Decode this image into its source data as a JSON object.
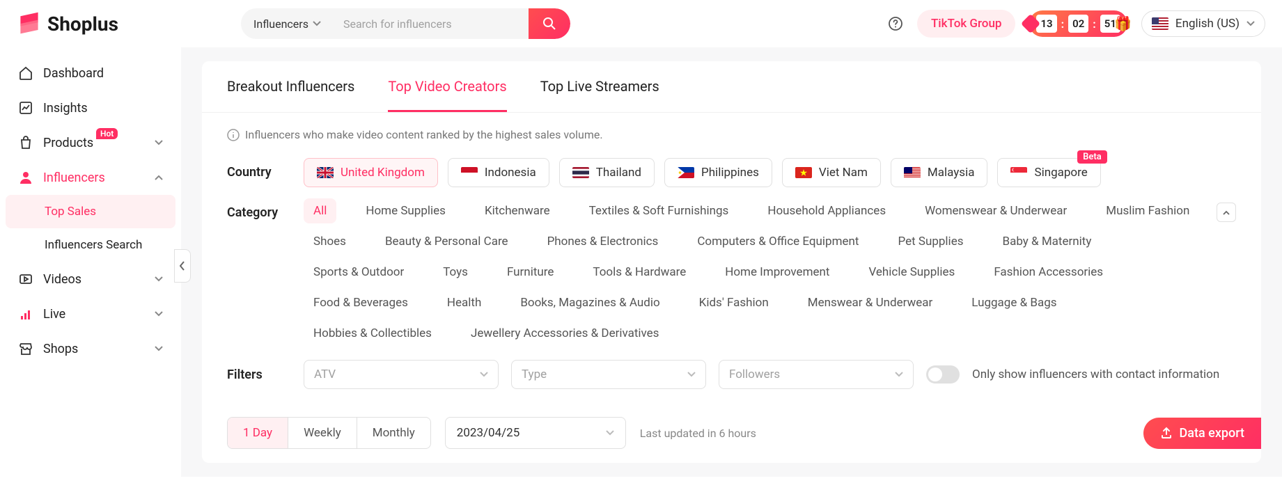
{
  "brand": "Shoplus",
  "header": {
    "search_category": "Influencers",
    "search_placeholder": "Search for influencers",
    "tiktok_group": "TikTok Group",
    "countdown": {
      "h": "13",
      "m": "02",
      "s": "51"
    },
    "language": "English (US)"
  },
  "sidebar": {
    "dashboard": "Dashboard",
    "insights": "Insights",
    "products": "Products",
    "products_badge": "Hot",
    "influencers": "Influencers",
    "influencers_sub": {
      "top_sales": "Top Sales",
      "search": "Influencers Search"
    },
    "videos": "Videos",
    "live": "Live",
    "shops": "Shops"
  },
  "tabs": {
    "breakout": "Breakout Influencers",
    "top_video": "Top Video Creators",
    "top_live": "Top Live Streamers"
  },
  "info_text": "Influencers who make video content ranked by the highest sales volume.",
  "labels": {
    "country": "Country",
    "category": "Category",
    "filters": "Filters"
  },
  "countries": [
    {
      "name": "United Kingdom",
      "flag": "uk",
      "active": true
    },
    {
      "name": "Indonesia",
      "flag": "id"
    },
    {
      "name": "Thailand",
      "flag": "th"
    },
    {
      "name": "Philippines",
      "flag": "ph"
    },
    {
      "name": "Viet Nam",
      "flag": "vn"
    },
    {
      "name": "Malaysia",
      "flag": "my"
    },
    {
      "name": "Singapore",
      "flag": "sg",
      "beta": true
    }
  ],
  "beta_label": "Beta",
  "categories": [
    "All",
    "Home Supplies",
    "Kitchenware",
    "Textiles & Soft Furnishings",
    "Household Appliances",
    "Womenswear & Underwear",
    "Muslim Fashion",
    "Shoes",
    "Beauty & Personal Care",
    "Phones & Electronics",
    "Computers & Office Equipment",
    "Pet Supplies",
    "Baby & Maternity",
    "Sports & Outdoor",
    "Toys",
    "Furniture",
    "Tools & Hardware",
    "Home Improvement",
    "Vehicle Supplies",
    "Fashion Accessories",
    "Food & Beverages",
    "Health",
    "Books, Magazines & Audio",
    "Kids' Fashion",
    "Menswear & Underwear",
    "Luggage & Bags",
    "Hobbies & Collectibles",
    "Jewellery Accessories & Derivatives"
  ],
  "filters": {
    "atv": "ATV",
    "type": "Type",
    "followers": "Followers",
    "contact_toggle": "Only show influencers with contact information"
  },
  "periods": {
    "day": "1 Day",
    "weekly": "Weekly",
    "monthly": "Monthly"
  },
  "date_value": "2023/04/25",
  "last_updated": "Last updated in 6 hours",
  "export_label": "Data export"
}
